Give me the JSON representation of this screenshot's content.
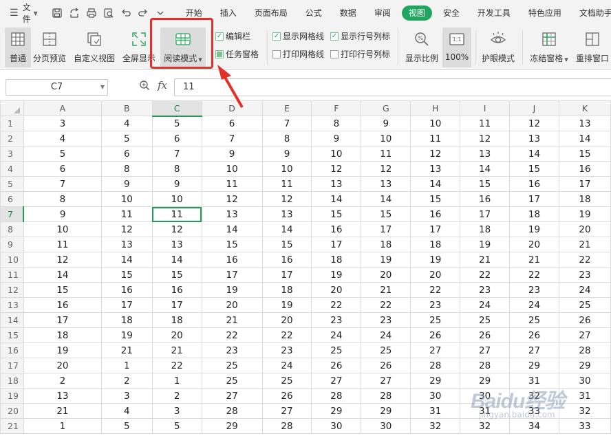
{
  "menubar": {
    "file_label": "文件",
    "tabs": [
      {
        "label": "开始",
        "active": false
      },
      {
        "label": "插入",
        "active": false
      },
      {
        "label": "页面布局",
        "active": false
      },
      {
        "label": "公式",
        "active": false
      },
      {
        "label": "数据",
        "active": false
      },
      {
        "label": "审阅",
        "active": false
      },
      {
        "label": "视图",
        "active": true
      },
      {
        "label": "安全",
        "active": false
      },
      {
        "label": "开发工具",
        "active": false
      },
      {
        "label": "特色应用",
        "active": false
      },
      {
        "label": "文档助手",
        "active": false
      }
    ],
    "quick_access_icons": [
      "save-icon",
      "export-icon",
      "print-icon",
      "print-preview-icon",
      "undo-icon",
      "redo-icon",
      "customize-icon"
    ]
  },
  "ribbon": {
    "normal": "普通",
    "page_break": "分页预览",
    "custom_view": "自定义视图",
    "fullscreen": "全屏显示",
    "reading_mode": "阅读模式",
    "formula_bar": "编辑栏",
    "task_pane": "任务窗格",
    "show_gridlines": "显示网格线",
    "print_gridlines": "打印网格线",
    "show_headers": "显示行号列标",
    "print_headers": "打印行号列标",
    "zoom": "显示比例",
    "zoom_value": "100%",
    "zoom_icon_label": "1:1",
    "eye_protection": "护眼模式",
    "freeze_panes": "冻结窗格",
    "arrange": "重排窗口",
    "accent_color": "#22a560",
    "highlight_color": "#e2312b"
  },
  "formula": {
    "cell_ref": "C7",
    "fx": "fx",
    "value": "11"
  },
  "sheet": {
    "columns": [
      "A",
      "B",
      "C",
      "D",
      "E",
      "F",
      "G",
      "H",
      "I",
      "J",
      "K"
    ],
    "selected_col": "C",
    "selected_row": 7,
    "rows": [
      {
        "n": "1",
        "cells": [
          "3",
          "4",
          "5",
          "6",
          "7",
          "8",
          "9",
          "10",
          "11",
          "12",
          "13"
        ]
      },
      {
        "n": "2",
        "cells": [
          "4",
          "5",
          "6",
          "7",
          "8",
          "9",
          "10",
          "11",
          "12",
          "13",
          "14"
        ]
      },
      {
        "n": "3",
        "cells": [
          "5",
          "6",
          "7",
          "9",
          "9",
          "10",
          "11",
          "12",
          "13",
          "14",
          "15"
        ]
      },
      {
        "n": "4",
        "cells": [
          "6",
          "8",
          "8",
          "10",
          "10",
          "12",
          "12",
          "13",
          "14",
          "15",
          "16"
        ]
      },
      {
        "n": "5",
        "cells": [
          "7",
          "9",
          "9",
          "11",
          "11",
          "13",
          "13",
          "14",
          "15",
          "16",
          "17"
        ]
      },
      {
        "n": "6",
        "cells": [
          "8",
          "10",
          "10",
          "12",
          "12",
          "14",
          "14",
          "15",
          "16",
          "17",
          "18"
        ]
      },
      {
        "n": "7",
        "cells": [
          "9",
          "11",
          "11",
          "13",
          "13",
          "15",
          "15",
          "16",
          "17",
          "18",
          "19"
        ]
      },
      {
        "n": "8",
        "cells": [
          "10",
          "12",
          "12",
          "14",
          "14",
          "16",
          "17",
          "17",
          "18",
          "19",
          "20"
        ]
      },
      {
        "n": "9",
        "cells": [
          "11",
          "13",
          "13",
          "15",
          "15",
          "17",
          "18",
          "18",
          "19",
          "20",
          "21"
        ]
      },
      {
        "n": "10",
        "cells": [
          "12",
          "14",
          "14",
          "16",
          "16",
          "18",
          "19",
          "19",
          "21",
          "21",
          "22"
        ]
      },
      {
        "n": "11",
        "cells": [
          "14",
          "15",
          "15",
          "17",
          "17",
          "19",
          "20",
          "20",
          "22",
          "22",
          "23"
        ]
      },
      {
        "n": "12",
        "cells": [
          "15",
          "16",
          "16",
          "19",
          "18",
          "20",
          "21",
          "22",
          "23",
          "23",
          "24"
        ]
      },
      {
        "n": "13",
        "cells": [
          "16",
          "17",
          "17",
          "20",
          "19",
          "22",
          "22",
          "23",
          "24",
          "24",
          "25"
        ]
      },
      {
        "n": "14",
        "cells": [
          "17",
          "18",
          "18",
          "21",
          "20",
          "23",
          "23",
          "25",
          "25",
          "25",
          "26"
        ]
      },
      {
        "n": "15",
        "cells": [
          "18",
          "19",
          "20",
          "22",
          "22",
          "24",
          "24",
          "26",
          "26",
          "26",
          "27"
        ]
      },
      {
        "n": "16",
        "cells": [
          "19",
          "21",
          "21",
          "23",
          "23",
          "25",
          "25",
          "27",
          "27",
          "27",
          "28"
        ]
      },
      {
        "n": "17",
        "cells": [
          "20",
          "1",
          "22",
          "25",
          "24",
          "26",
          "26",
          "28",
          "28",
          "29",
          "29"
        ]
      },
      {
        "n": "18",
        "cells": [
          "2",
          "2",
          "1",
          "25",
          "25",
          "27",
          "27",
          "29",
          "29",
          "31",
          "30"
        ]
      },
      {
        "n": "19",
        "cells": [
          "13",
          "3",
          "2",
          "27",
          "26",
          "28",
          "28",
          "30",
          "30",
          "32",
          "31"
        ]
      },
      {
        "n": "20",
        "cells": [
          "21",
          "4",
          "3",
          "28",
          "27",
          "29",
          "29",
          "31",
          "31",
          "33",
          "32"
        ]
      },
      {
        "n": "21",
        "cells": [
          "1",
          "5",
          "5",
          "29",
          "28",
          "30",
          "30",
          "32",
          "32",
          "34",
          "33"
        ]
      }
    ]
  },
  "watermark": {
    "logo": "Baidu经验",
    "url": "jingyan.baidu.com"
  }
}
